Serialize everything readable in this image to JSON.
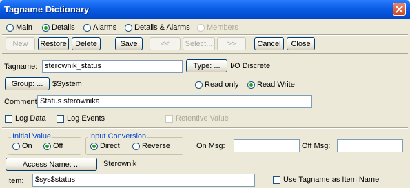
{
  "window": {
    "title": "Tagname Dictionary"
  },
  "view_tabs": [
    {
      "label": "Main",
      "selected": false,
      "enabled": true
    },
    {
      "label": "Details",
      "selected": true,
      "enabled": true
    },
    {
      "label": "Alarms",
      "selected": false,
      "enabled": true
    },
    {
      "label": "Details & Alarms",
      "selected": false,
      "enabled": true
    },
    {
      "label": "Members",
      "selected": false,
      "enabled": false
    }
  ],
  "toolbar": {
    "new": "New",
    "restore": "Restore",
    "delete": "Delete",
    "save": "Save",
    "first": "<<",
    "select": "Select...",
    "last": ">>",
    "cancel": "Cancel",
    "close": "Close"
  },
  "tag": {
    "tagname_label": "Tagname:",
    "tagname_value": "sterownik_status",
    "type_button": "Type: ...",
    "type_value": "I/O Discrete",
    "group_button": "Group: ...",
    "group_value": "$System",
    "read_only": "Read only",
    "read_write": "Read Write",
    "access": "read_write",
    "comment_label": "Comment:",
    "comment_value": "Status sterownika",
    "log_data": "Log Data",
    "log_events": "Log Events",
    "retentive": "Retentive Value"
  },
  "details": {
    "initial_value_title": "Initial Value",
    "on": "On",
    "off": "Off",
    "initial": "off",
    "input_conversion_title": "Input Conversion",
    "direct": "Direct",
    "reverse": "Reverse",
    "conversion": "direct",
    "on_msg_label": "On Msg:",
    "on_msg_value": "",
    "off_msg_label": "Off Msg:",
    "off_msg_value": "",
    "access_name_button": "Access Name: ...",
    "access_name_value": "Sterownik",
    "item_label": "Item:",
    "item_value": "$sys$status",
    "use_tagname": "Use Tagname as Item Name"
  }
}
